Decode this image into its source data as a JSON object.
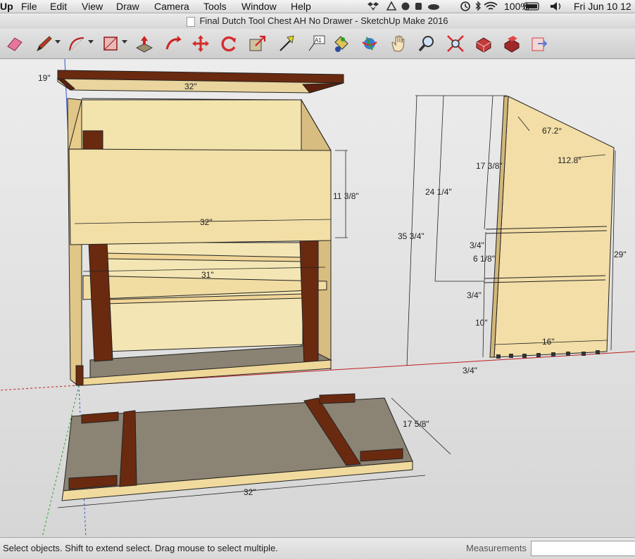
{
  "menubar": {
    "app": "Up",
    "items": [
      "File",
      "Edit",
      "View",
      "Draw",
      "Camera",
      "Tools",
      "Window",
      "Help"
    ],
    "battery": "100%",
    "clock": "Fri Jun 10  12"
  },
  "window": {
    "title": "Final Dutch Tool Chest AH No Drawer - SketchUp Make 2016"
  },
  "toolbar": {
    "tools": [
      "eraser",
      "pencil",
      "arc",
      "rectangle",
      "push-pull",
      "follow-me",
      "move",
      "rotate",
      "scale",
      "tape-measure",
      "text",
      "paint-bucket",
      "orbit",
      "pan",
      "zoom",
      "zoom-extents",
      "warehouse",
      "extension-warehouse",
      "share"
    ]
  },
  "dimensions": {
    "front": {
      "top_left": "19\"",
      "lid_width": "32\"",
      "front_height": "11 3/8\"",
      "front_width": "32\"",
      "shelf_width": "31\""
    },
    "side": {
      "total_height": "35 3/4\"",
      "mid_height": "24 1/4\"",
      "top_section": "17 3/8\"",
      "angle_top": "67.2°",
      "angle_right": "112.8°",
      "rail_a": "3/4\"",
      "middle_section": "6 1/8\"",
      "rail_b": "3/4\"",
      "bottom_section": "10\"",
      "base": "3/4\"",
      "depth": "16\"",
      "right_height": "29\""
    },
    "bottom": {
      "depth": "17 5/8\"",
      "width": "32\""
    }
  },
  "status": {
    "message": "Select objects. Shift to extend select. Drag mouse to select multiple.",
    "measurements_label": "Measurements",
    "measurements_value": ""
  },
  "colors": {
    "wood_light": "#f1dca2",
    "wood_mid": "#e8cd8a",
    "wood_dark": "#6a2a10",
    "floor_gray": "#8b8374",
    "axis_red": "#c02020",
    "axis_green": "#29a629",
    "axis_blue": "#3355cc"
  }
}
